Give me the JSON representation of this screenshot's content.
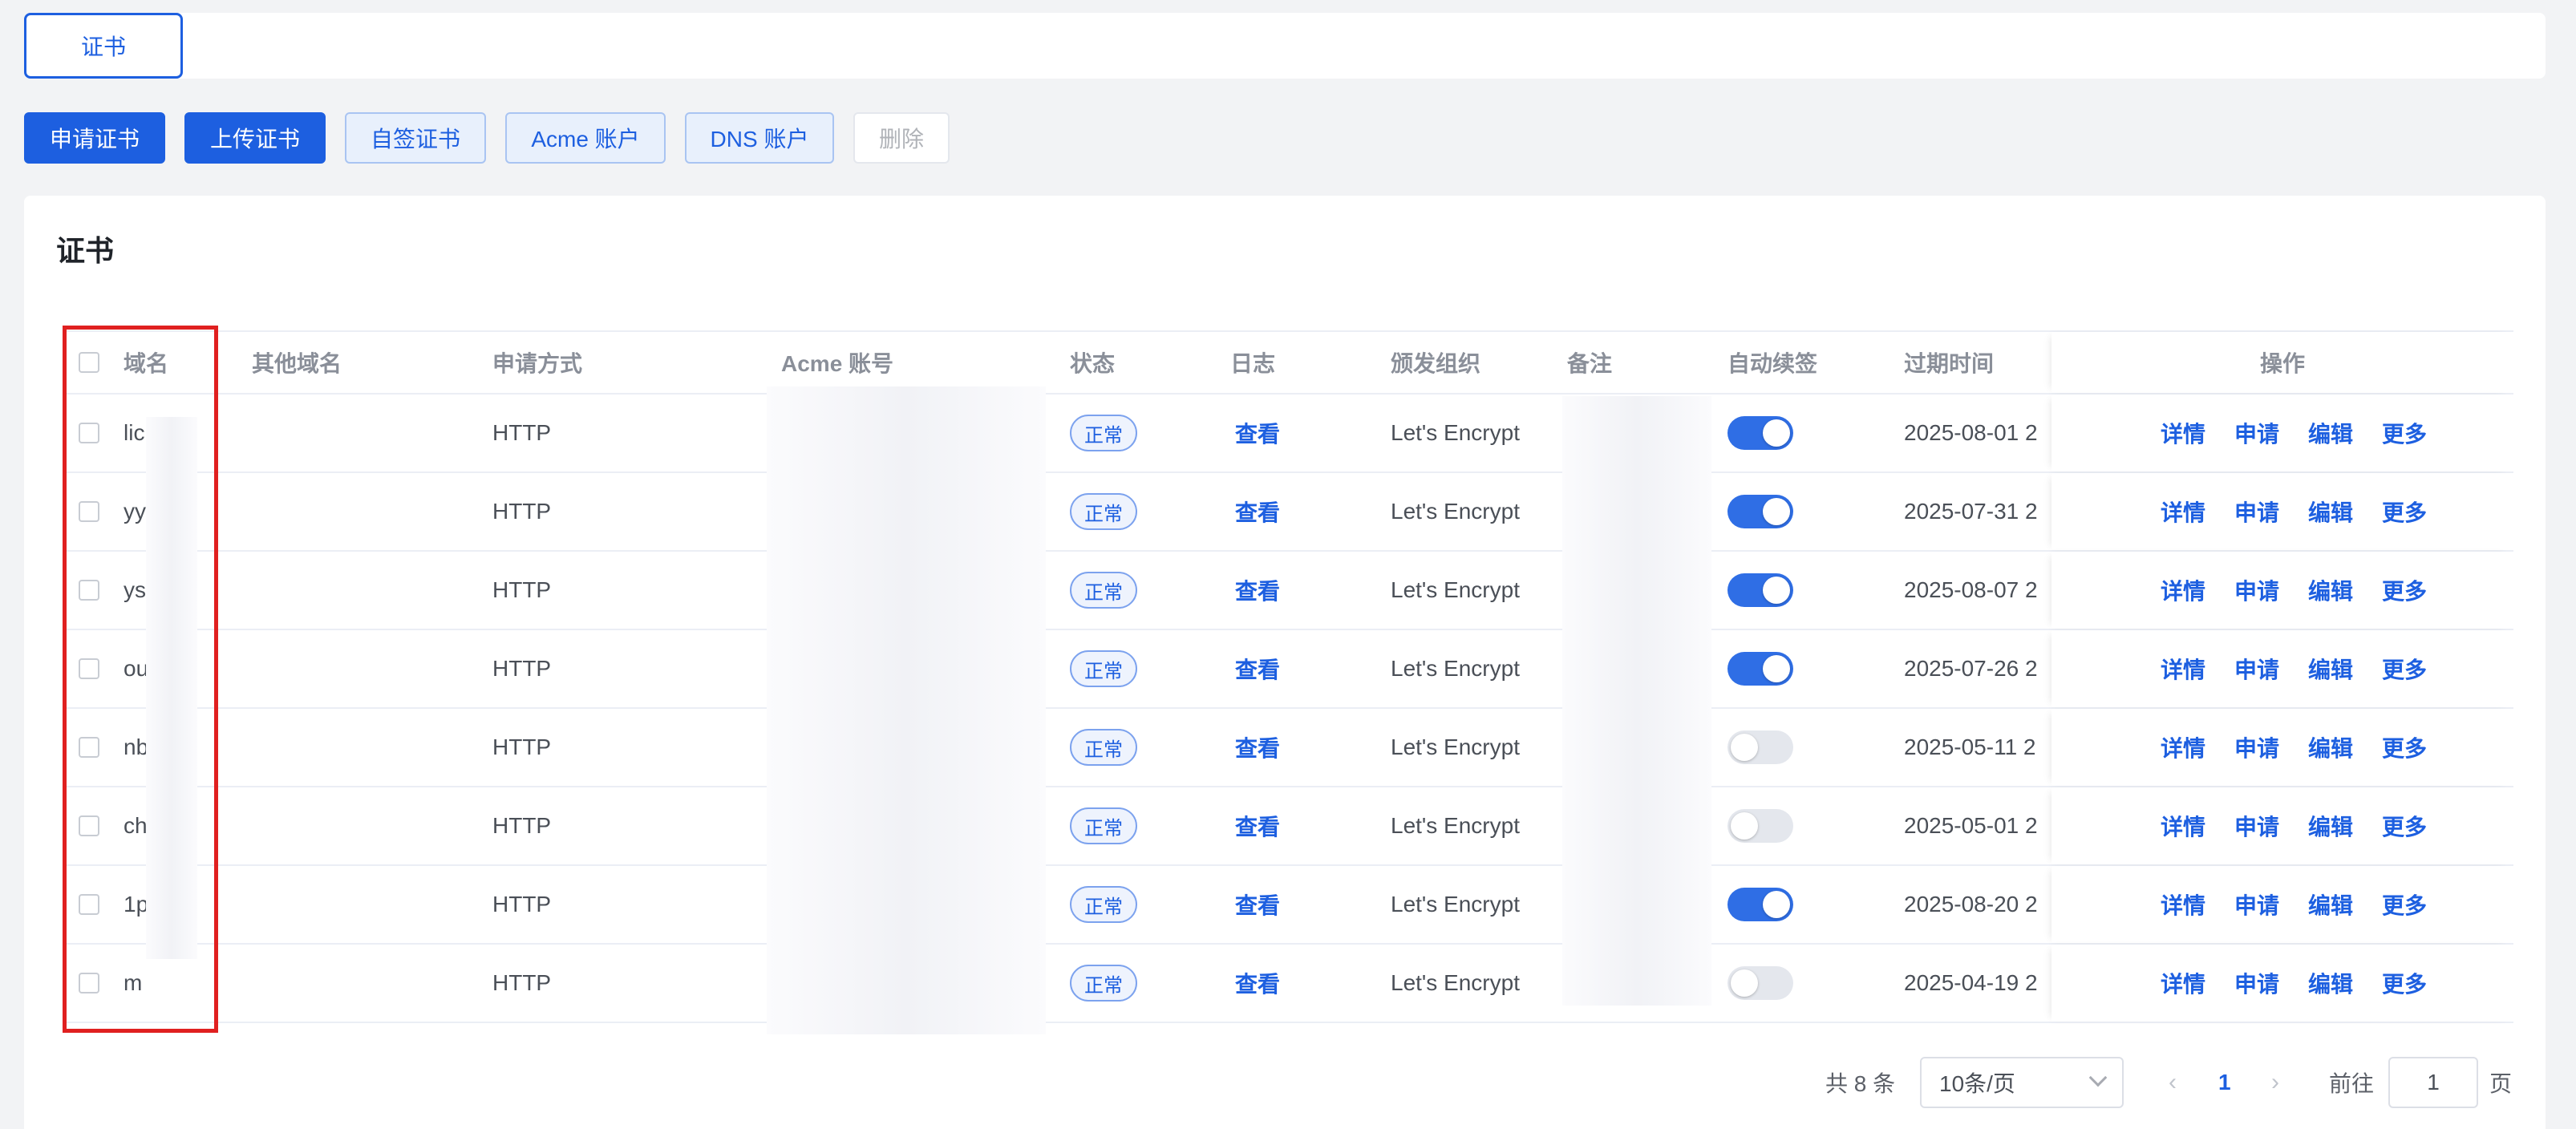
{
  "tabs": [
    {
      "label": "证书",
      "active": true
    }
  ],
  "toolbar": {
    "apply_cert": "申请证书",
    "upload_cert": "上传证书",
    "self_signed": "自签证书",
    "acme_account": "Acme 账户",
    "dns_account": "DNS 账户",
    "delete": "删除"
  },
  "card": {
    "title": "证书"
  },
  "table": {
    "headers": {
      "domain": "域名",
      "other_domains": "其他域名",
      "apply_method": "申请方式",
      "acme_account": "Acme 账号",
      "status": "状态",
      "log": "日志",
      "issuer": "颁发组织",
      "remark": "备注",
      "auto_renew": "自动续签",
      "expire": "过期时间",
      "actions": "操作"
    },
    "action_labels": {
      "detail": "详情",
      "apply": "申请",
      "edit": "编辑",
      "more": "更多"
    },
    "rows": [
      {
        "domain": "lic",
        "method": "HTTP",
        "status": "正常",
        "log": "查看",
        "issuer": "Let's Encrypt",
        "auto_renew": true,
        "expire": "2025-08-01 2"
      },
      {
        "domain": "yy",
        "method": "HTTP",
        "status": "正常",
        "log": "查看",
        "issuer": "Let's Encrypt",
        "auto_renew": true,
        "expire": "2025-07-31 2"
      },
      {
        "domain": "ys",
        "method": "HTTP",
        "status": "正常",
        "log": "查看",
        "issuer": "Let's Encrypt",
        "auto_renew": true,
        "expire": "2025-08-07 2"
      },
      {
        "domain": "ou",
        "method": "HTTP",
        "status": "正常",
        "log": "查看",
        "issuer": "Let's Encrypt",
        "auto_renew": true,
        "expire": "2025-07-26 2"
      },
      {
        "domain": "nb",
        "method": "HTTP",
        "status": "正常",
        "log": "查看",
        "issuer": "Let's Encrypt",
        "auto_renew": false,
        "expire": "2025-05-11 2"
      },
      {
        "domain": "ch",
        "method": "HTTP",
        "status": "正常",
        "log": "查看",
        "issuer": "Let's Encrypt",
        "auto_renew": false,
        "expire": "2025-05-01 2"
      },
      {
        "domain": "1p",
        "method": "HTTP",
        "status": "正常",
        "log": "查看",
        "issuer": "Let's Encrypt",
        "auto_renew": true,
        "expire": "2025-08-20 2"
      },
      {
        "domain": "m",
        "method": "HTTP",
        "status": "正常",
        "log": "查看",
        "issuer": "Let's Encrypt",
        "auto_renew": false,
        "expire": "2025-04-19 2"
      }
    ]
  },
  "pagination": {
    "total": "共 8 条",
    "page_size": "10条/页",
    "current": "1",
    "goto_label": "前往",
    "goto_value": "1",
    "page_suffix": "页",
    "prev_icon": "‹",
    "next_icon": "›"
  },
  "colors": {
    "primary": "#1d5fe0",
    "highlight": "#e02020"
  }
}
